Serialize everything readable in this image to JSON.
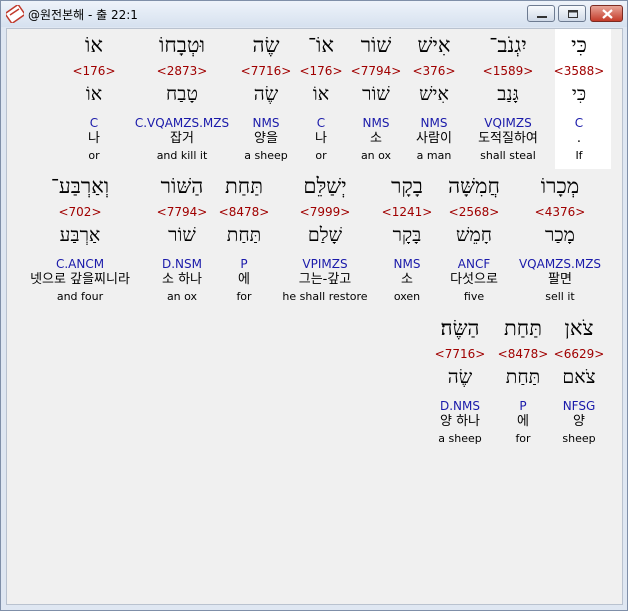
{
  "window": {
    "title": "@원전본해 - 출 22:1"
  },
  "controls": {
    "minimize": "minimize-icon",
    "maximize": "maximize-icon",
    "close": "close-icon"
  },
  "lines": [
    {
      "words": [
        {
          "heb": "כִּי",
          "strong": "<3588>",
          "lemma": "כִּי",
          "morph": "C",
          "kor": ".",
          "eng": "If"
        },
        {
          "heb": "יִגְנֹב־",
          "strong": "<1589>",
          "lemma": "גָּנַב",
          "morph": "VQIMZS",
          "kor": "도적질하여",
          "eng": "shall steal"
        },
        {
          "heb": "אִישׁ",
          "strong": "<376>",
          "lemma": "אִישׁ",
          "morph": "NMS",
          "kor": "사람이",
          "eng": "a man"
        },
        {
          "heb": "שׁוֹר",
          "strong": "<7794>",
          "lemma": "שׁוֹר",
          "morph": "NMS",
          "kor": "소",
          "eng": "an ox"
        },
        {
          "heb": "אוֹ־",
          "strong": "<176>",
          "lemma": "אוֹ",
          "morph": "C",
          "kor": "나",
          "eng": "or"
        },
        {
          "heb": "שֶׂה",
          "strong": "<7716>",
          "lemma": "שֶׂה",
          "morph": "NMS",
          "kor": "양을",
          "eng": "a sheep"
        },
        {
          "heb": "וּטְבָחוֹ",
          "strong": "<2873>",
          "lemma": "טָבַח",
          "morph": "C.VQAMZS.MZS",
          "kor": "잡거",
          "eng": "and kill it"
        },
        {
          "heb": "אוֹ",
          "strong": "<176>",
          "lemma": "אוֹ",
          "morph": "C",
          "kor": "나",
          "eng": "or"
        }
      ]
    },
    {
      "words": [
        {
          "heb": "מְכָרוֹ",
          "strong": "<4376>",
          "lemma": "מָכַר",
          "morph": "VQAMZS.MZS",
          "kor": "팔면",
          "eng": "sell it"
        },
        {
          "heb": "חֲמִשָּׁה",
          "strong": "<2568>",
          "lemma": "חָמֵשׁ",
          "morph": "ANCF",
          "kor": "다섯으로",
          "eng": "five"
        },
        {
          "heb": "בָקָר",
          "strong": "<1241>",
          "lemma": "בָּקָר",
          "morph": "NMS",
          "kor": "소",
          "eng": "oxen"
        },
        {
          "heb": "יְשַׁלֵּם",
          "strong": "<7999>",
          "lemma": "שָׁלַם",
          "morph": "VPIMZS",
          "kor": "그는-갚고",
          "eng": "he shall restore"
        },
        {
          "heb": "תַּחַת",
          "strong": "<8478>",
          "lemma": "תַּחַת",
          "morph": "P",
          "kor": "에",
          "eng": "for"
        },
        {
          "heb": "הַשּׁוֹר",
          "strong": "<7794>",
          "lemma": "שׁוֹר",
          "morph": "D.NSM",
          "kor": "소 하나",
          "eng": "an ox"
        },
        {
          "heb": "וְאַרְבַּע־",
          "strong": "<702>",
          "lemma": "אַרְבַּע",
          "morph": "C.ANCM",
          "kor": "넷으로 갚을찌니라",
          "eng": "and four"
        }
      ]
    },
    {
      "words": [
        {
          "heb": "צֹאן",
          "strong": "<6629>",
          "lemma": "צֹאם",
          "morph": "NFSG",
          "kor": "양",
          "eng": "sheep"
        },
        {
          "heb": "תַּחַת",
          "strong": "<8478>",
          "lemma": "תַּחַת",
          "morph": "P",
          "kor": "에",
          "eng": "for"
        },
        {
          "heb": "הַשֶּׂה׃",
          "strong": "<7716>",
          "lemma": "שֶׂה",
          "morph": "D.NMS",
          "kor": "양 하나",
          "eng": "a sheep"
        }
      ]
    }
  ]
}
